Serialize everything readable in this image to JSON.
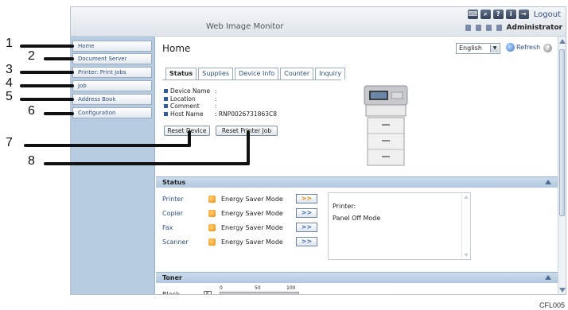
{
  "header": {
    "title": "Web Image Monitor",
    "logout_label": "Logout",
    "user": "Administrator"
  },
  "leftnav": {
    "items": [
      {
        "label": "Home"
      },
      {
        "label": "Document Server"
      },
      {
        "label": "Printer: Print Jobs"
      },
      {
        "label": "Job"
      },
      {
        "label": "Address Book"
      },
      {
        "label": "Configuration"
      }
    ]
  },
  "main": {
    "page_title": "Home",
    "language": "English",
    "refresh_label": "Refresh",
    "tabs": [
      {
        "label": "Status"
      },
      {
        "label": "Supplies"
      },
      {
        "label": "Device Info"
      },
      {
        "label": "Counter"
      },
      {
        "label": "Inquiry"
      }
    ],
    "device_info": [
      {
        "label": "Device Name",
        "value": ""
      },
      {
        "label": "Location",
        "value": ""
      },
      {
        "label": "Comment",
        "value": ""
      },
      {
        "label": "Host Name",
        "value": "RNP0026731863C8"
      }
    ],
    "buttons": {
      "reset_device": "Reset Device",
      "reset_printer_job": "Reset Printer Job"
    }
  },
  "status_section": {
    "title": "Status",
    "devices": [
      {
        "name": "Printer",
        "status": "Energy Saver Mode"
      },
      {
        "name": "Copier",
        "status": "Energy Saver Mode"
      },
      {
        "name": "Fax",
        "status": "Energy Saver Mode"
      },
      {
        "name": "Scanner",
        "status": "Energy Saver Mode"
      }
    ],
    "message_line1": "Printer:",
    "message_line2": "Panel Off Mode"
  },
  "toner_section": {
    "title": "Toner",
    "color": "Black",
    "scale": [
      "0",
      "50",
      "100"
    ]
  },
  "callouts": [
    "1",
    "2",
    "3",
    "4",
    "5",
    "6",
    "7",
    "8"
  ],
  "figure_code": "CFL005"
}
